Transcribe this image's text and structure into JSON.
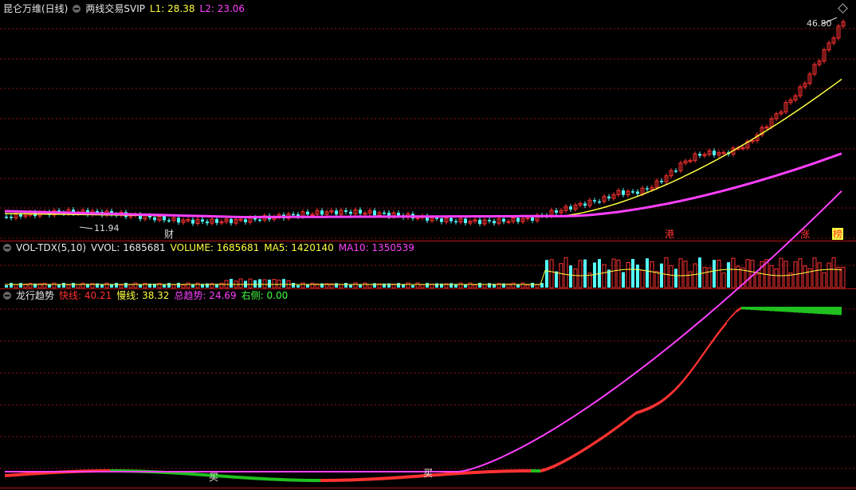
{
  "main": {
    "stock_title": "昆仑万维(日线)",
    "indicator_name": "两线交易SVIP",
    "l1": "L1: 28.38",
    "l2": "L2: 23.06",
    "high_label": "46.80",
    "low_label": "11.94",
    "markers": [
      "财",
      "港",
      "涨",
      "榜"
    ]
  },
  "volume": {
    "title": "VOL-TDX(5,10)",
    "vvol": "VVOL: 1685681",
    "volume": "VOLUME: 1685681",
    "ma5": "MA5: 1420140",
    "ma10": "MA10: 1350539"
  },
  "trend": {
    "title": "龙行趋势",
    "fast": "快线: 40.21",
    "slow": "慢线: 38.32",
    "total": "总趋势: 24.69",
    "right": "右侧: 0.00",
    "buy_marks": [
      "买",
      "买"
    ]
  },
  "colors": {
    "up": "#ff3232",
    "down": "#54fcfc",
    "ma_yellow": "#ffff40",
    "ma_magenta": "#ff40ff",
    "grid": "#8a1414"
  }
}
